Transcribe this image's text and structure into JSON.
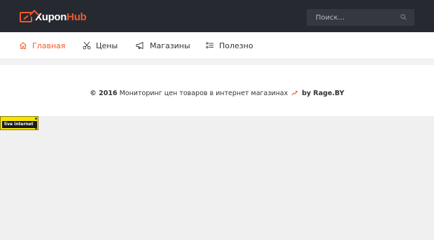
{
  "header": {
    "logo_part1": "Xupon",
    "logo_part2": "Hub",
    "search_placeholder": "Поиск..."
  },
  "nav": {
    "items": [
      {
        "label": "Главная",
        "icon": "home-icon",
        "active": true
      },
      {
        "label": "Цены",
        "icon": "scissors-icon",
        "active": false
      },
      {
        "label": "Магазины",
        "icon": "megaphone-icon",
        "active": false
      },
      {
        "label": "Полезно",
        "icon": "list-icon",
        "active": false
      }
    ]
  },
  "footer": {
    "copyright": "© 2016",
    "text": "Мониторинг цен товаров в интернет магазинах",
    "by_text": "by Rage.BY"
  },
  "counter": {
    "label": "live internet"
  },
  "colors": {
    "accent": "#f0592a",
    "topbar": "#262930"
  }
}
